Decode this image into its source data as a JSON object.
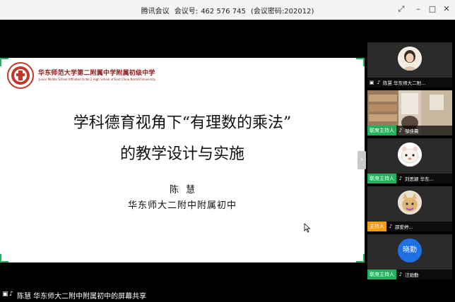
{
  "window": {
    "app_name": "腾讯会议",
    "meeting_id_label": "会议号:",
    "meeting_id": "462 576 745",
    "password": "(会议密码:202012)"
  },
  "slide": {
    "school_cn": "华东师范大学第二附属中学附属初级中学",
    "school_en": "Junior Middle School Affiliated to No.2 High School of East China Normal University",
    "title_line1": "学科德育视角下“有理数的乘法”",
    "title_line2": "的教学设计与实施",
    "author": "陈慧",
    "author_org": "华东师大二附中附属初中"
  },
  "participants": [
    {
      "name": "陈慧 华东师大二附...",
      "tag": "",
      "avatar": "person-photo",
      "active": false
    },
    {
      "name": "邹佳晨",
      "tag": "联席主持人",
      "avatar": "room-video",
      "active": true
    },
    {
      "name": "刘思颖 华东...",
      "tag": "联席主持人",
      "avatar": "cartoon-avatar",
      "active": false
    },
    {
      "name": "邵爱婷...",
      "tag": "主持人",
      "avatar": "cat-avatar",
      "active": false
    },
    {
      "name": "汪勋勤",
      "tag": "联席主持人",
      "avatar_text": "晓勤",
      "avatar": "text-avatar",
      "active": false
    }
  ],
  "bottom": {
    "share_label": "陈慧 华东师大二附中附属初中的屏幕共享"
  },
  "colors": {
    "accent": "#21b35b",
    "host_orange": "#f39c12",
    "avatar_blue": "#1f6fe5",
    "slide_red": "#8b1a1a"
  }
}
